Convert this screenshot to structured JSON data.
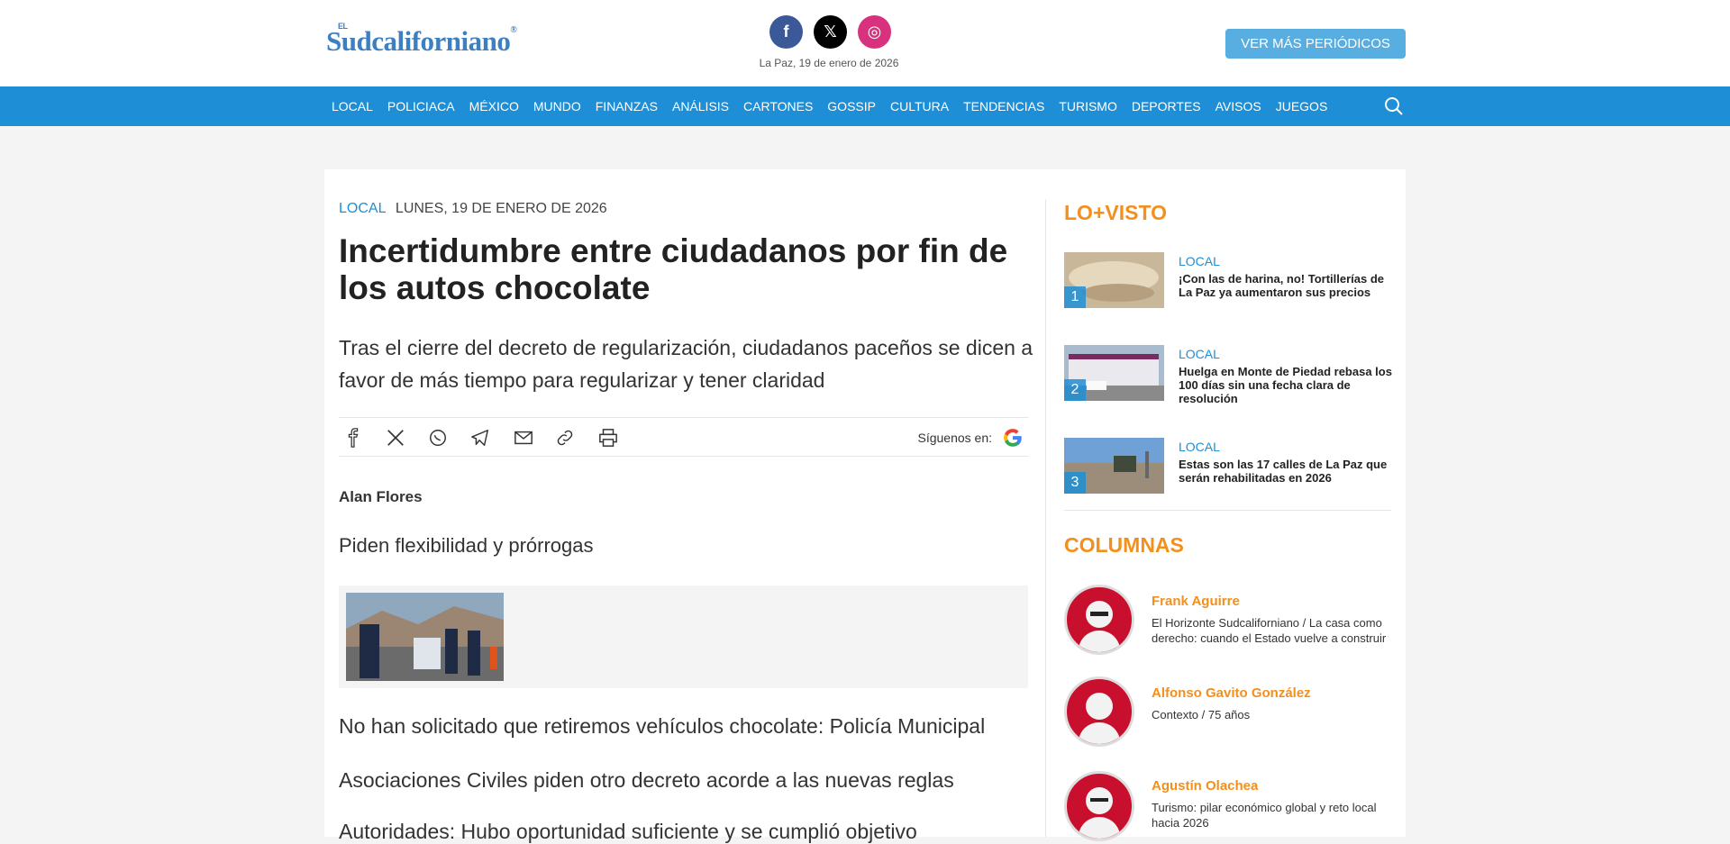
{
  "header": {
    "logo_el": "EL",
    "logo_name": "Sudcaliforniano",
    "logo_reg": "®",
    "date": "La Paz, 19 de enero de 2026",
    "more_button": "VER MÁS PERIÓDICOS",
    "social": [
      {
        "name": "facebook-icon",
        "glyph": "f"
      },
      {
        "name": "x-icon",
        "glyph": "𝕏"
      },
      {
        "name": "instagram-icon",
        "glyph": "◎"
      }
    ]
  },
  "nav": {
    "items": [
      "LOCAL",
      "POLICIACA",
      "MÉXICO",
      "MUNDO",
      "FINANZAS",
      "ANÁLISIS",
      "CARTONES",
      "GOSSIP",
      "CULTURA",
      "TENDENCIAS",
      "TURISMO",
      "DEPORTES",
      "AVISOS",
      "JUEGOS"
    ]
  },
  "article": {
    "category": "LOCAL",
    "date": "LUNES, 19 DE ENERO DE 2026",
    "headline": "Incertidumbre entre ciudadanos por fin de los autos chocolate",
    "summary": "Tras el cierre del decreto de regularización, ciudadanos paceños se dicen a favor de más tiempo para regularizar y tener claridad",
    "follow_label": "Síguenos en:",
    "author": "Alan Flores",
    "related": [
      "Piden flexibilidad y prórrogas",
      "No han solicitado que retiremos vehículos chocolate: Policía Municipal",
      "Asociaciones Civiles piden otro decreto acorde a las nuevas reglas",
      "Autoridades: Hubo oportunidad suficiente y se cumplió objetivo"
    ]
  },
  "sidebar": {
    "lo_visto_title": "LO+VISTO",
    "lo_visto": [
      {
        "num": "1",
        "category": "LOCAL",
        "text": "¡Con las de harina, no! Tortillerías de La Paz ya aumentaron sus precios"
      },
      {
        "num": "2",
        "category": "LOCAL",
        "text": "Huelga en Monte de Piedad rebasa los 100 días sin una fecha clara de resolución"
      },
      {
        "num": "3",
        "category": "LOCAL",
        "text": "Estas son las 17 calles de La Paz que serán rehabilitadas en 2026"
      }
    ],
    "columnas_title": "COLUMNAS",
    "columnas": [
      {
        "name": "Frank Aguirre",
        "desc": "El Horizonte Sudcaliforniano / La casa como derecho: cuando el Estado vuelve a construir"
      },
      {
        "name": "Alfonso Gavito González",
        "desc": "Contexto / 75 años"
      },
      {
        "name": "Agustín Olachea",
        "desc": "Turismo: pilar económico global y reto local hacia 2026"
      }
    ]
  },
  "colors": {
    "brand_blue": "#1e8fd6",
    "accent_orange": "#f3901d"
  }
}
